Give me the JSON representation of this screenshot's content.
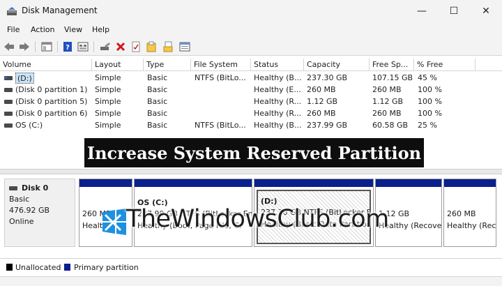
{
  "window": {
    "title": "Disk Management",
    "controls": {
      "minimize": "—",
      "maximize": "☐",
      "close": "✕"
    }
  },
  "menu": [
    "File",
    "Action",
    "View",
    "Help"
  ],
  "volume_list": {
    "columns": [
      "Volume",
      "Layout",
      "Type",
      "File System",
      "Status",
      "Capacity",
      "Free Sp...",
      "% Free"
    ],
    "rows": [
      {
        "volume": "(D:)",
        "layout": "Simple",
        "type": "Basic",
        "fs": "NTFS (BitLo...",
        "status": "Healthy (B...",
        "capacity": "237.30 GB",
        "free": "107.15 GB",
        "pct": "45 %",
        "selected": true
      },
      {
        "volume": "(Disk 0 partition 1)",
        "layout": "Simple",
        "type": "Basic",
        "fs": "",
        "status": "Healthy (E...",
        "capacity": "260 MB",
        "free": "260 MB",
        "pct": "100 %",
        "selected": false
      },
      {
        "volume": "(Disk 0 partition 5)",
        "layout": "Simple",
        "type": "Basic",
        "fs": "",
        "status": "Healthy (R...",
        "capacity": "1.12 GB",
        "free": "1.12 GB",
        "pct": "100 %",
        "selected": false
      },
      {
        "volume": "(Disk 0 partition 6)",
        "layout": "Simple",
        "type": "Basic",
        "fs": "",
        "status": "Healthy (R...",
        "capacity": "260 MB",
        "free": "260 MB",
        "pct": "100 %",
        "selected": false
      },
      {
        "volume": "OS (C:)",
        "layout": "Simple",
        "type": "Basic",
        "fs": "NTFS (BitLo...",
        "status": "Healthy (B...",
        "capacity": "237.99 GB",
        "free": "60.58 GB",
        "pct": "25 %",
        "selected": false
      }
    ]
  },
  "banner": {
    "text": "Increase System Reserved Partition"
  },
  "disk": {
    "name": "Disk 0",
    "type": "Basic",
    "size": "476.92 GB",
    "state": "Online",
    "partitions": [
      {
        "title": "",
        "line1": "260 MB",
        "line2": "Healt"
      },
      {
        "title": "OS  (C:)",
        "line1": "237.99 GB NTFS (BitLocker En",
        "line2": "Healthy (Boot, Page File, Cr"
      },
      {
        "title": "(D:)",
        "line1": "237.30 GB NTFS (BitLocker En",
        "line2": "Healthy (Basic Data Partition"
      },
      {
        "title": "",
        "line1": "1.12 GB",
        "line2": "Healthy (Recove"
      },
      {
        "title": "",
        "line1": "260 MB",
        "line2": "Healthy (Rec"
      }
    ]
  },
  "watermark": {
    "text": "TheWindowsClub.com"
  },
  "legend": [
    {
      "label": "Unallocated",
      "color": "#000000"
    },
    {
      "label": "Primary partition",
      "color": "#0b1f8e"
    }
  ],
  "colors": {
    "primary_partition": "#0b1f8e",
    "selection": "#cce4f7",
    "chrome": "#f3f3f3"
  }
}
